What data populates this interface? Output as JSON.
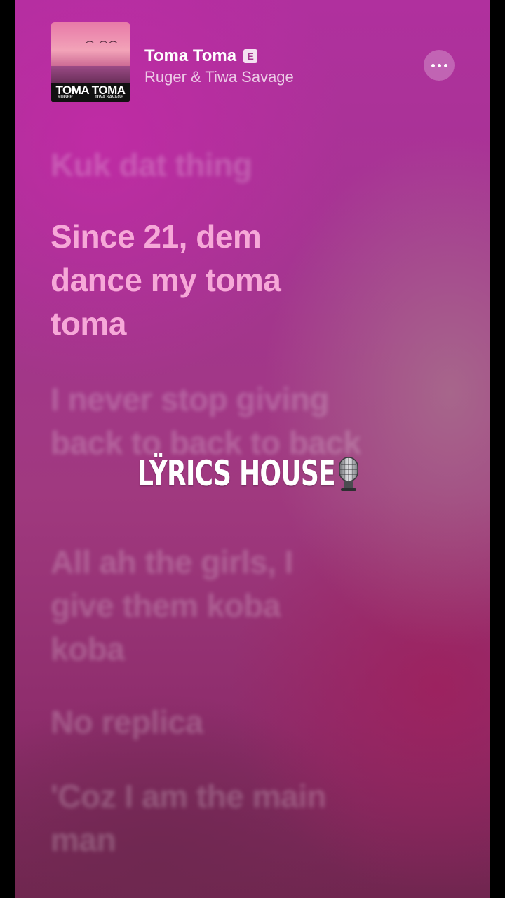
{
  "now_playing": {
    "title": "Toma Toma",
    "explicit_badge": "E",
    "artist": "Ruger & Tiwa Savage",
    "artwork": {
      "title": "TOMA TOMA",
      "artist_left": "RUGER",
      "artist_right": "TIWA SAVAGE"
    }
  },
  "lyrics": [
    {
      "text": "Kuk dat thing",
      "state": "past"
    },
    {
      "text": "Since 21, dem dance my toma toma",
      "state": "active"
    },
    {
      "text": "I never stop giving back to back to back",
      "state": "upcoming"
    },
    {
      "text": "All ah the girls, I give them koba koba",
      "state": "upcoming"
    },
    {
      "text": "No replica",
      "state": "upcoming"
    },
    {
      "text": "'Coz I am the main man",
      "state": "upcoming"
    }
  ],
  "watermark": {
    "text": "LŸRICS HOUSE",
    "icon": "microphone-icon"
  },
  "colors": {
    "active_lyric": "#f6a8d8",
    "background": "#a43590"
  }
}
